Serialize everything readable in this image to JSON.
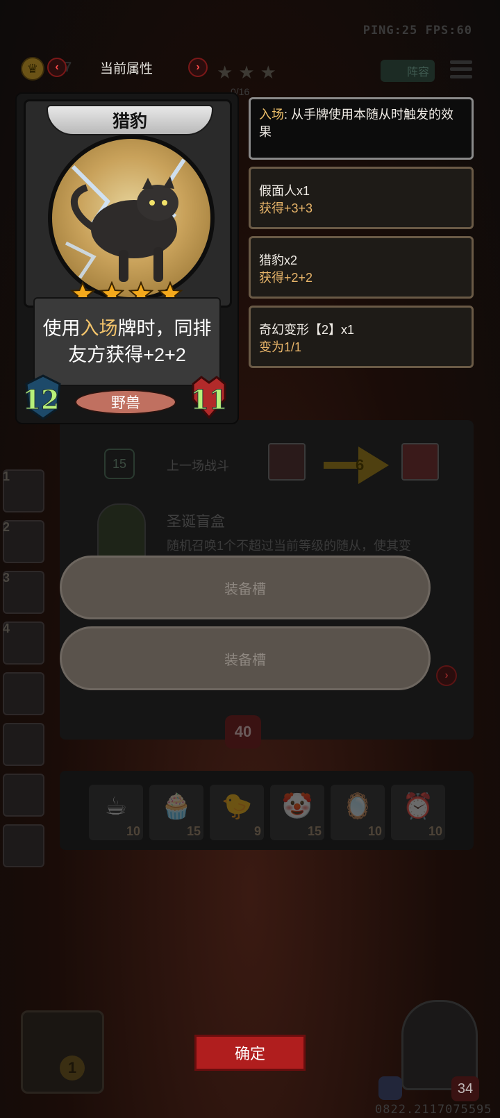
{
  "hud": {
    "ping_fps": "PING:25   FPS:60",
    "hidden_number": "7",
    "page_title": "当前属性",
    "lineup_label": "阵容",
    "card_count": "0/16",
    "stars_count": 3
  },
  "card": {
    "name": "猎豹",
    "stars": 4,
    "desc_prefix": "使用",
    "desc_keyword": "入场",
    "desc_rest_line1": "牌时，同排",
    "desc_line2": "友方获得+2+2",
    "attack": "12",
    "health": "11",
    "tribe": "野兽"
  },
  "tooltips": [
    {
      "keyword": "入场",
      "sep": ": ",
      "desc": "从手牌使用本随从时触发的效果"
    },
    {
      "name": "假面人x1",
      "effect": "获得+3+3"
    },
    {
      "name": "猎豹x2",
      "effect": "获得+2+2"
    },
    {
      "name": "奇幻变形【2】x1",
      "effect": "变为1/1"
    }
  ],
  "background_panel": {
    "level_shield": "15",
    "last_battle_label": "上一场战斗",
    "battle_result": "6",
    "event_title": "圣诞盲盒",
    "event_desc": "随机召唤1个不超过当前等级的随从，使其变",
    "boss_hp": "40"
  },
  "equipment_slots": [
    "装备槽",
    "装备槽"
  ],
  "items": [
    {
      "icon": "teacup-icon",
      "glyph": "☕",
      "count": "10"
    },
    {
      "icon": "cupcake-icon",
      "glyph": "🧁",
      "count": "15"
    },
    {
      "icon": "rubber-chicken-icon",
      "glyph": "🐤",
      "count": "9"
    },
    {
      "icon": "clown-icon",
      "glyph": "🤡",
      "count": "15"
    },
    {
      "icon": "mirror-icon",
      "glyph": "🪞",
      "count": "10"
    },
    {
      "icon": "alarm-clock-icon",
      "glyph": "⏰",
      "count": "10"
    }
  ],
  "side_list": [
    "1",
    "2",
    "3",
    "4",
    "",
    "",
    "",
    ""
  ],
  "bottom": {
    "confirm_label": "确定",
    "left_level": "1",
    "player_hp": "34",
    "session_id": "0822.2117075595"
  },
  "colors": {
    "keyword": "#f2c36b",
    "effect": "#e8b56a",
    "stat_green": "#b6f07a",
    "confirm_red": "#b01e1e"
  }
}
